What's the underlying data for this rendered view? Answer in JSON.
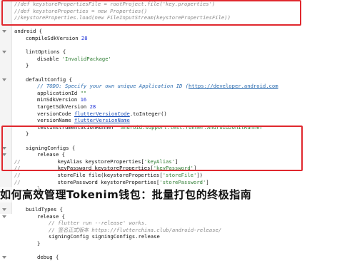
{
  "code_lines": [
    {
      "indent": 0,
      "segments": [
        {
          "c": "cm",
          "t": "//def keystorePropertiesFile = rootProject.file('key.properties')"
        }
      ]
    },
    {
      "indent": 0,
      "segments": [
        {
          "c": "cm",
          "t": "//def keystoreProperties = new Properties()"
        }
      ]
    },
    {
      "indent": 0,
      "segments": [
        {
          "c": "cm",
          "t": "//keystoreProperties.load(new FileInputStream(keystorePropertiesFile))"
        }
      ]
    },
    {
      "indent": 0,
      "segments": []
    },
    {
      "indent": 0,
      "segments": [
        {
          "c": "k",
          "t": "android {"
        }
      ]
    },
    {
      "indent": 1,
      "segments": [
        {
          "c": "k",
          "t": "compileSdkVersion "
        },
        {
          "c": "num",
          "t": "28"
        }
      ]
    },
    {
      "indent": 0,
      "segments": []
    },
    {
      "indent": 1,
      "segments": [
        {
          "c": "k",
          "t": "lintOptions {"
        }
      ]
    },
    {
      "indent": 2,
      "segments": [
        {
          "c": "k",
          "t": "disable "
        },
        {
          "c": "str",
          "t": "'InvalidPackage'"
        }
      ]
    },
    {
      "indent": 1,
      "segments": [
        {
          "c": "k",
          "t": "}"
        }
      ]
    },
    {
      "indent": 0,
      "segments": []
    },
    {
      "indent": 1,
      "segments": [
        {
          "c": "k",
          "t": "defaultConfig {"
        }
      ]
    },
    {
      "indent": 2,
      "segments": [
        {
          "c": "todo",
          "t": "// TODO: Specify your own unique Application ID ("
        },
        {
          "c": "link",
          "t": "https://developer.android.com"
        }
      ]
    },
    {
      "indent": 2,
      "segments": [
        {
          "c": "k",
          "t": "applicationId "
        },
        {
          "c": "str",
          "t": "\"\""
        }
      ]
    },
    {
      "indent": 2,
      "segments": [
        {
          "c": "k",
          "t": "minSdkVersion "
        },
        {
          "c": "num",
          "t": "16"
        }
      ]
    },
    {
      "indent": 2,
      "segments": [
        {
          "c": "k",
          "t": "targetSdkVersion "
        },
        {
          "c": "num",
          "t": "28"
        }
      ]
    },
    {
      "indent": 2,
      "segments": [
        {
          "c": "k",
          "t": "versionCode "
        },
        {
          "c": "fn",
          "t": "flutterVersionCode"
        },
        {
          "c": "k",
          "t": ".toInteger()"
        }
      ]
    },
    {
      "indent": 2,
      "segments": [
        {
          "c": "k",
          "t": "versionName "
        },
        {
          "c": "fn",
          "t": "flutterVersionName"
        }
      ]
    },
    {
      "indent": 2,
      "segments": [
        {
          "c": "k",
          "t": "testInstrumentationRunner "
        },
        {
          "c": "str",
          "t": "\"android.support.test.runner.AndroidJUnitRunner\""
        }
      ]
    },
    {
      "indent": 1,
      "segments": [
        {
          "c": "k",
          "t": "}"
        }
      ]
    },
    {
      "indent": 0,
      "segments": []
    },
    {
      "indent": 1,
      "segments": [
        {
          "c": "k",
          "t": "signingConfigs {"
        }
      ]
    },
    {
      "indent": 2,
      "segments": [
        {
          "c": "k",
          "t": "release {"
        }
      ]
    },
    {
      "indent": 0,
      "segments": [
        {
          "c": "cm",
          "t": "//"
        },
        {
          "c": "k",
          "t": "            keyAlias keystoreProperties["
        },
        {
          "c": "str",
          "t": "'keyAlias'"
        },
        {
          "c": "k",
          "t": "]"
        }
      ]
    },
    {
      "indent": 0,
      "segments": [
        {
          "c": "cm",
          "t": "//"
        },
        {
          "c": "k",
          "t": "            keyPassword keystoreProperties["
        },
        {
          "c": "str",
          "t": "'keyPassword'"
        },
        {
          "c": "k",
          "t": "]"
        }
      ]
    },
    {
      "indent": 0,
      "segments": [
        {
          "c": "cm",
          "t": "//"
        },
        {
          "c": "k",
          "t": "            storeFile file(keystoreProperties["
        },
        {
          "c": "str",
          "t": "'storeFile'"
        },
        {
          "c": "k",
          "t": "])"
        }
      ]
    },
    {
      "indent": 0,
      "segments": [
        {
          "c": "cm",
          "t": "//"
        },
        {
          "c": "k",
          "t": "            storePassword keystoreProperties["
        },
        {
          "c": "str",
          "t": "'storePassword'"
        },
        {
          "c": "k",
          "t": "]"
        }
      ]
    },
    {
      "indent": 2,
      "segments": [
        {
          "c": "k",
          "t": "}"
        }
      ]
    },
    {
      "indent": 1,
      "segments": [
        {
          "c": "k",
          "t": "}"
        }
      ]
    },
    {
      "indent": 0,
      "segments": []
    },
    {
      "indent": 1,
      "segments": [
        {
          "c": "k",
          "t": "buildTypes {"
        }
      ]
    },
    {
      "indent": 2,
      "segments": [
        {
          "c": "k",
          "t": "release {"
        }
      ]
    },
    {
      "indent": 3,
      "segments": [
        {
          "c": "cm",
          "t": "// flutter run --release' works."
        }
      ]
    },
    {
      "indent": 3,
      "segments": [
        {
          "c": "cm",
          "t": "// 签名正式版本 https://flutterchina.club/android-release/"
        }
      ]
    },
    {
      "indent": 3,
      "segments": [
        {
          "c": "k",
          "t": "signingConfig signingConfigs.release"
        }
      ]
    },
    {
      "indent": 2,
      "segments": [
        {
          "c": "k",
          "t": "}"
        }
      ]
    },
    {
      "indent": 0,
      "segments": []
    },
    {
      "indent": 2,
      "segments": [
        {
          "c": "k",
          "t": "debug {"
        }
      ]
    }
  ],
  "fold_markers": [
    4,
    7,
    11,
    21,
    22,
    30,
    31,
    37
  ],
  "caption": "如何高效管理Tokenim钱包：批量打包的终极指南",
  "colors": {
    "highlight_box": "#e0282e",
    "comment": "#8a8a8a",
    "string": "#2e7d32",
    "number": "#1b2fd6"
  }
}
